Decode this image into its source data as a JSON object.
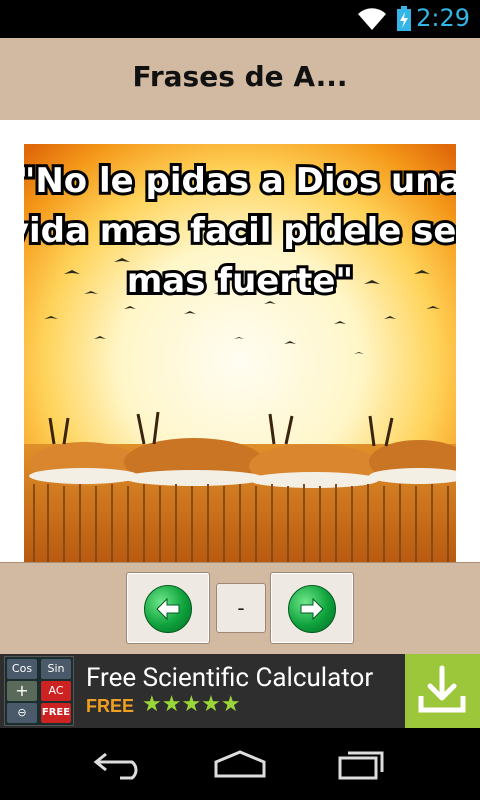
{
  "status": {
    "time": "2:29"
  },
  "app": {
    "title": "Frases de A..."
  },
  "image": {
    "quote_lines": [
      "\"No le pidas a Dios una",
      "vida mas facil pidele ser",
      "mas fuerte\""
    ]
  },
  "toolbar": {
    "counter": "-"
  },
  "ad": {
    "title": "Free Scientific Calculator",
    "free_label": "FREE",
    "stars": "★★★★★",
    "icon_keys": [
      "Cos",
      "Sin",
      "+",
      "AC",
      "⊖",
      "FREE"
    ]
  }
}
